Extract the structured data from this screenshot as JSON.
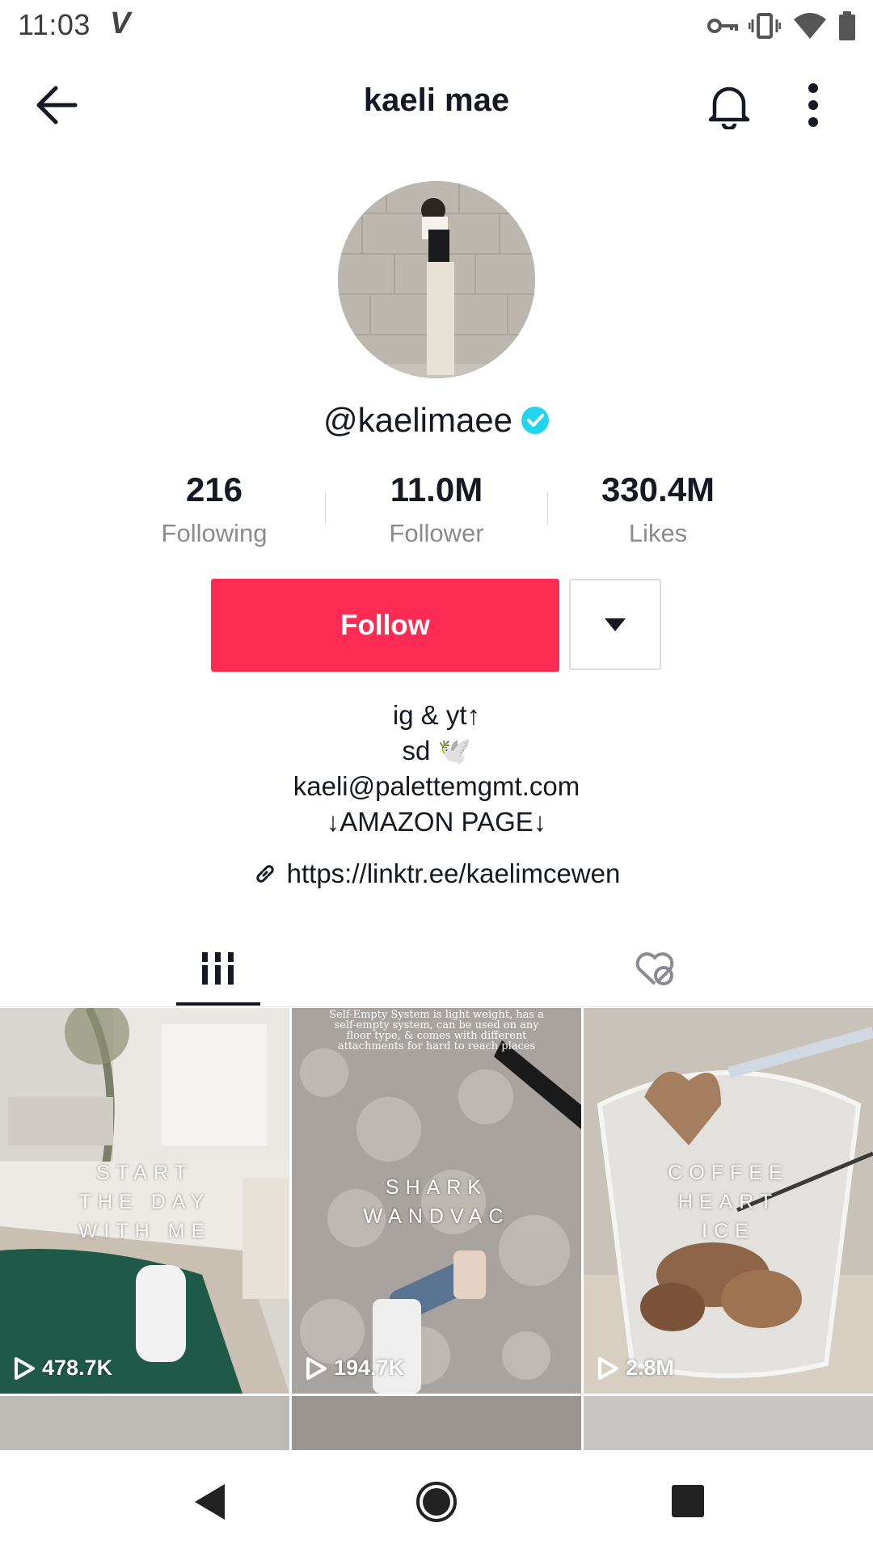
{
  "status": {
    "time": "11:03"
  },
  "header": {
    "title": "kaeli mae"
  },
  "profile": {
    "username": "@kaelimaee",
    "stats": [
      {
        "value": "216",
        "label": "Following"
      },
      {
        "value": "11.0M",
        "label": "Follower"
      },
      {
        "value": "330.4M",
        "label": "Likes"
      }
    ],
    "follow_label": "Follow",
    "bio": [
      "ig & yt↑",
      "sd 🕊️",
      "kaeli@palettemgmt.com",
      "↓AMAZON PAGE↓"
    ],
    "link": "https://linktr.ee/kaelimcewen"
  },
  "videos": [
    {
      "caption": "START\nTHE DAY\nWITH ME",
      "views": "478.7K"
    },
    {
      "caption": "SHARK\nWANDVAC",
      "views": "194.7K",
      "note": "Self-Empty System is light weight, has a self-empty system, can be used on any floor type, & comes with different attachments for hard to reach places"
    },
    {
      "caption": "COFFEE\nHEART\nICE",
      "views": "2.8M"
    }
  ],
  "icons": {
    "back": "arrow-left-icon",
    "bell": "bell-icon",
    "more": "more-vertical-icon",
    "verified": "verified-badge-icon",
    "link": "link-icon",
    "videos_tab": "grid-icon",
    "liked_tab": "liked-hidden-icon"
  },
  "colors": {
    "follow": "#fe2c55",
    "verified": "#20d5ec",
    "text": "#161823",
    "muted": "#8a8b91"
  }
}
